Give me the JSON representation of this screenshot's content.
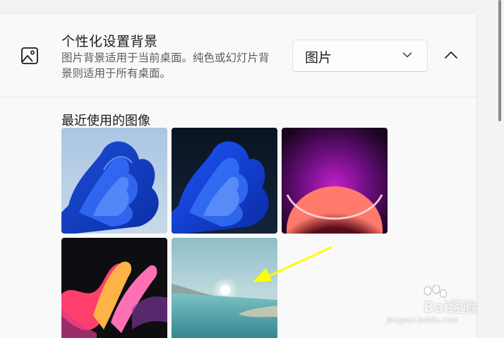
{
  "setting": {
    "title": "个性化设置背景",
    "description": "图片背景适用于当前桌面。纯色或幻灯片背景则适用于所有桌面。",
    "icon": "picture-icon"
  },
  "dropdown": {
    "selected": "图片",
    "icon": "chevron-down-icon"
  },
  "collapse_icon": "chevron-up-icon",
  "recent": {
    "label": "最近使用的图像",
    "images": [
      {
        "name": "bloom-light"
      },
      {
        "name": "bloom-dark"
      },
      {
        "name": "purple-glow"
      },
      {
        "name": "ribbon-flow"
      },
      {
        "name": "sunrise-lake"
      }
    ]
  },
  "annotation": {
    "arrow_color": "#ffff00"
  },
  "watermark": {
    "brand": "Bai经验",
    "url": "jingyan.baidu.com"
  }
}
